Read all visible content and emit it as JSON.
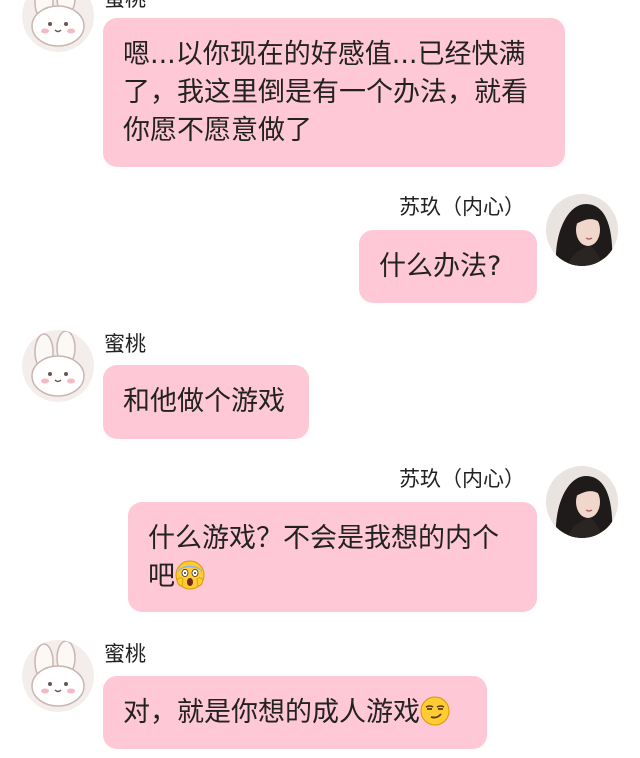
{
  "messages": [
    {
      "sender": "蜜桃",
      "lines": [
        "嗯...以你现在的好感值...已经快满",
        "了，我这里倒是有一个办法，就看",
        "你愿不愿意做了"
      ]
    },
    {
      "sender": "苏玖（内心）",
      "lines": [
        "什么办法?"
      ]
    },
    {
      "sender": "蜜桃",
      "lines": [
        "和他做个游戏"
      ]
    },
    {
      "sender": "苏玖（内心）",
      "lines": [
        "什么游戏？不会是我想的内个",
        "吧"
      ],
      "emoji": "screaming-face-emoji"
    },
    {
      "sender": "蜜桃",
      "lines": [
        "对，就是你想的成人游戏"
      ],
      "emoji": "smirking-face-emoji"
    }
  ],
  "colors": {
    "bubble": "#ffc8d6",
    "background": "#ffffff",
    "text": "#222222"
  },
  "icons": {
    "left_avatar": "cartoon-bunny-avatar-icon",
    "right_avatar": "girl-portrait-avatar-icon"
  }
}
